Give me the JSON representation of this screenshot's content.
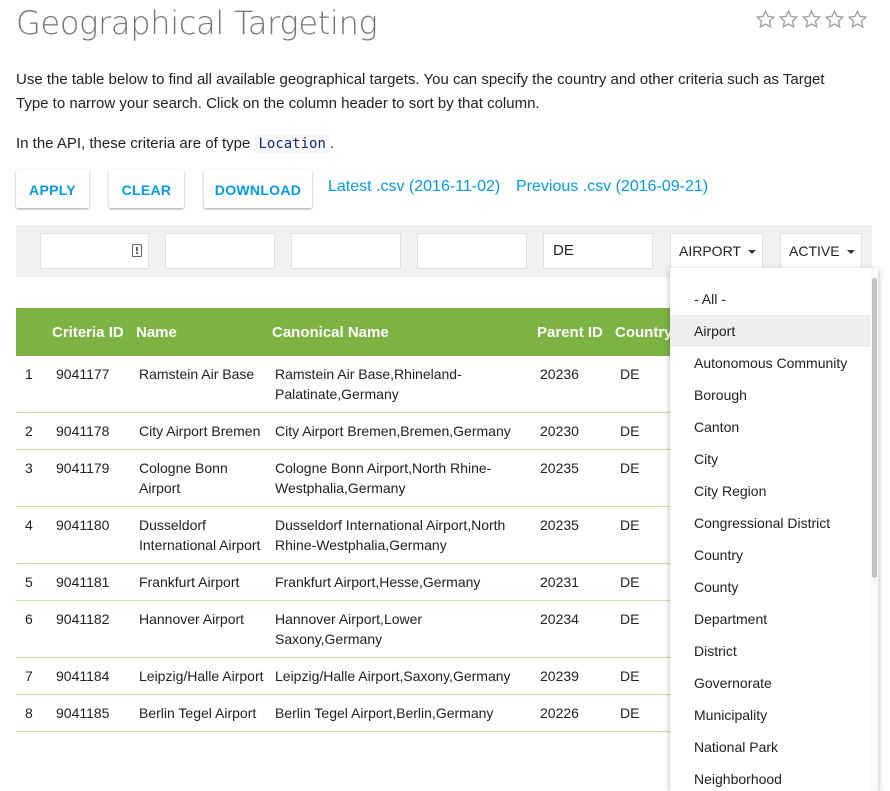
{
  "page": {
    "title": "Geographical Targeting",
    "intro": "Use the table below to find all available geographical targets. You can specify the country and other criteria such as Target Type to narrow your search. Click on the column header to sort by that column.",
    "api_prefix": "In the API, these criteria are of type ",
    "api_type": "Location",
    "api_suffix": "."
  },
  "rating": {
    "stars_filled": 0,
    "stars_total": 5
  },
  "toolbar": {
    "apply": "APPLY",
    "clear": "CLEAR",
    "download": "DOWNLOAD",
    "latest_csv": "Latest .csv (2016-11-02)",
    "previous_csv": "Previous .csv (2016-09-21)"
  },
  "filters": {
    "criteria_id": "",
    "name": "",
    "canonical_name": "",
    "parent_id": "",
    "country_code": "DE",
    "target_type": "AIRPORT",
    "status": "ACTIVE"
  },
  "table": {
    "headers": [
      "",
      "Criteria ID",
      "Name",
      "Canonical Name",
      "Parent ID",
      "Country"
    ],
    "rows": [
      {
        "n": "1",
        "id": "9041177",
        "name": "Ramstein Air Base",
        "canonical": "Ramstein Air Base,Rhineland-Palatinate,Germany",
        "parent": "20236",
        "country": "DE"
      },
      {
        "n": "2",
        "id": "9041178",
        "name": "City Airport Bremen",
        "canonical": "City Airport Bremen,Bremen,Germany",
        "parent": "20230",
        "country": "DE"
      },
      {
        "n": "3",
        "id": "9041179",
        "name": "Cologne Bonn Airport",
        "canonical": "Cologne Bonn Airport,North Rhine-Westphalia,Germany",
        "parent": "20235",
        "country": "DE"
      },
      {
        "n": "4",
        "id": "9041180",
        "name": "Dusseldorf International Airport",
        "canonical": "Dusseldorf International Airport,North Rhine-Westphalia,Germany",
        "parent": "20235",
        "country": "DE"
      },
      {
        "n": "5",
        "id": "9041181",
        "name": "Frankfurt Airport",
        "canonical": "Frankfurt Airport,Hesse,Germany",
        "parent": "20231",
        "country": "DE"
      },
      {
        "n": "6",
        "id": "9041182",
        "name": "Hannover Airport",
        "canonical": "Hannover Airport,Lower Saxony,Germany",
        "parent": "20234",
        "country": "DE"
      },
      {
        "n": "7",
        "id": "9041184",
        "name": "Leipzig/Halle Airport",
        "canonical": "Leipzig/Halle Airport,Saxony,Germany",
        "parent": "20239",
        "country": "DE"
      },
      {
        "n": "8",
        "id": "9041185",
        "name": "Berlin Tegel Airport",
        "canonical": "Berlin Tegel Airport,Berlin,Germany",
        "parent": "20226",
        "country": "DE"
      }
    ]
  },
  "target_type_dropdown": {
    "selected": "Airport",
    "options": [
      "- All -",
      "Airport",
      "Autonomous Community",
      "Borough",
      "Canton",
      "City",
      "City Region",
      "Congressional District",
      "Country",
      "County",
      "Department",
      "District",
      "Governorate",
      "Municipality",
      "National Park",
      "Neighborhood"
    ]
  },
  "colors": {
    "accent": "#039be5",
    "table_header": "#7cb342",
    "row_divider": "#c5e1a5",
    "filter_bar": "#f1f1f1"
  }
}
